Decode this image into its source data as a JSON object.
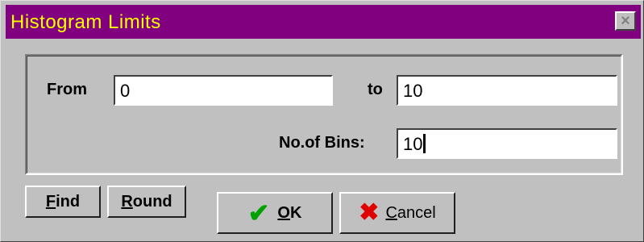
{
  "window": {
    "title": "Histogram Limits",
    "close_glyph": "×"
  },
  "form": {
    "from_label": "From",
    "from_value": "0",
    "to_label": "to",
    "to_value": "10",
    "bins_label": "No.of Bins:",
    "bins_value": "10"
  },
  "buttons": {
    "find": {
      "first": "F",
      "rest": "ind"
    },
    "round": {
      "first": "R",
      "rest": "ound"
    },
    "ok": {
      "first": "O",
      "rest": "K",
      "icon": "checkmark-icon"
    },
    "cancel": {
      "first": "C",
      "rest": "ancel",
      "icon": "x-icon"
    }
  },
  "colors": {
    "titlebar": "#800080",
    "title_text": "#ffff00",
    "face": "#c0c0c0",
    "ok_icon": "#00a000",
    "cancel_icon": "#e00000"
  }
}
